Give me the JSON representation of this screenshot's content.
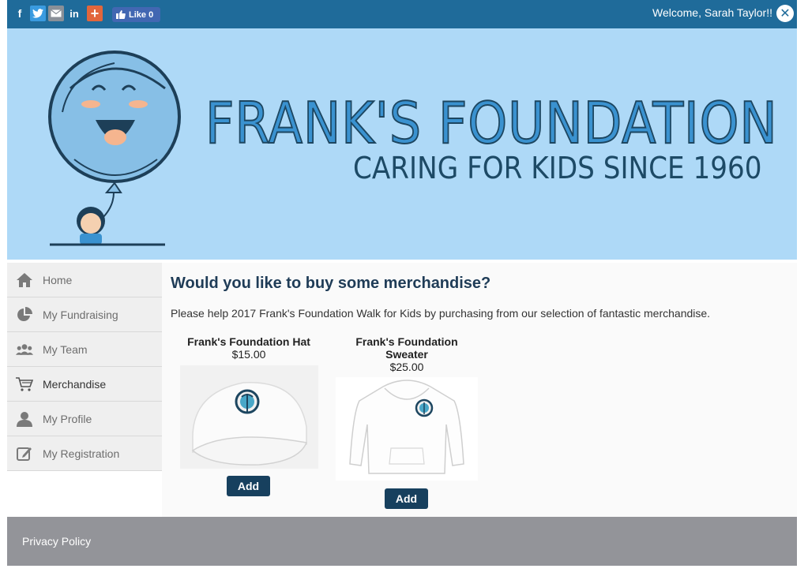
{
  "topbar": {
    "share": {
      "facebook": "f",
      "twitter": "t",
      "email": "email-icon",
      "linkedin": "in",
      "more": "+"
    },
    "like_label": "Like 0",
    "welcome_text": "Welcome, Sarah Taylor!!"
  },
  "banner": {
    "title": "FRANK'S FOUNDATION",
    "subtitle": "CARING FOR KIDS SINCE 1960"
  },
  "sidebar": {
    "items": [
      {
        "label": "Home",
        "icon": "home-icon"
      },
      {
        "label": "My Fundraising",
        "icon": "pie-chart-icon"
      },
      {
        "label": "My Team",
        "icon": "team-icon"
      },
      {
        "label": "Merchandise",
        "icon": "cart-icon"
      },
      {
        "label": "My Profile",
        "icon": "person-icon"
      },
      {
        "label": "My Registration",
        "icon": "edit-icon"
      }
    ]
  },
  "main": {
    "heading": "Would you like to buy some merchandise?",
    "intro": "Please help 2017 Frank's Foundation Walk for Kids by purchasing from our selection of fantastic merchandise.",
    "products": [
      {
        "name": "Frank's Foundation Hat",
        "price": "$15.00",
        "button": "Add"
      },
      {
        "name_line1": "Frank's Foundation",
        "name_line2": "Sweater",
        "price": "$25.00",
        "button": "Add"
      }
    ]
  },
  "footer": {
    "privacy_label": "Privacy Policy"
  },
  "colors": {
    "topbar": "#1f6b9a",
    "banner": "#aed9f7",
    "button": "#17405e",
    "footer": "#939499"
  }
}
